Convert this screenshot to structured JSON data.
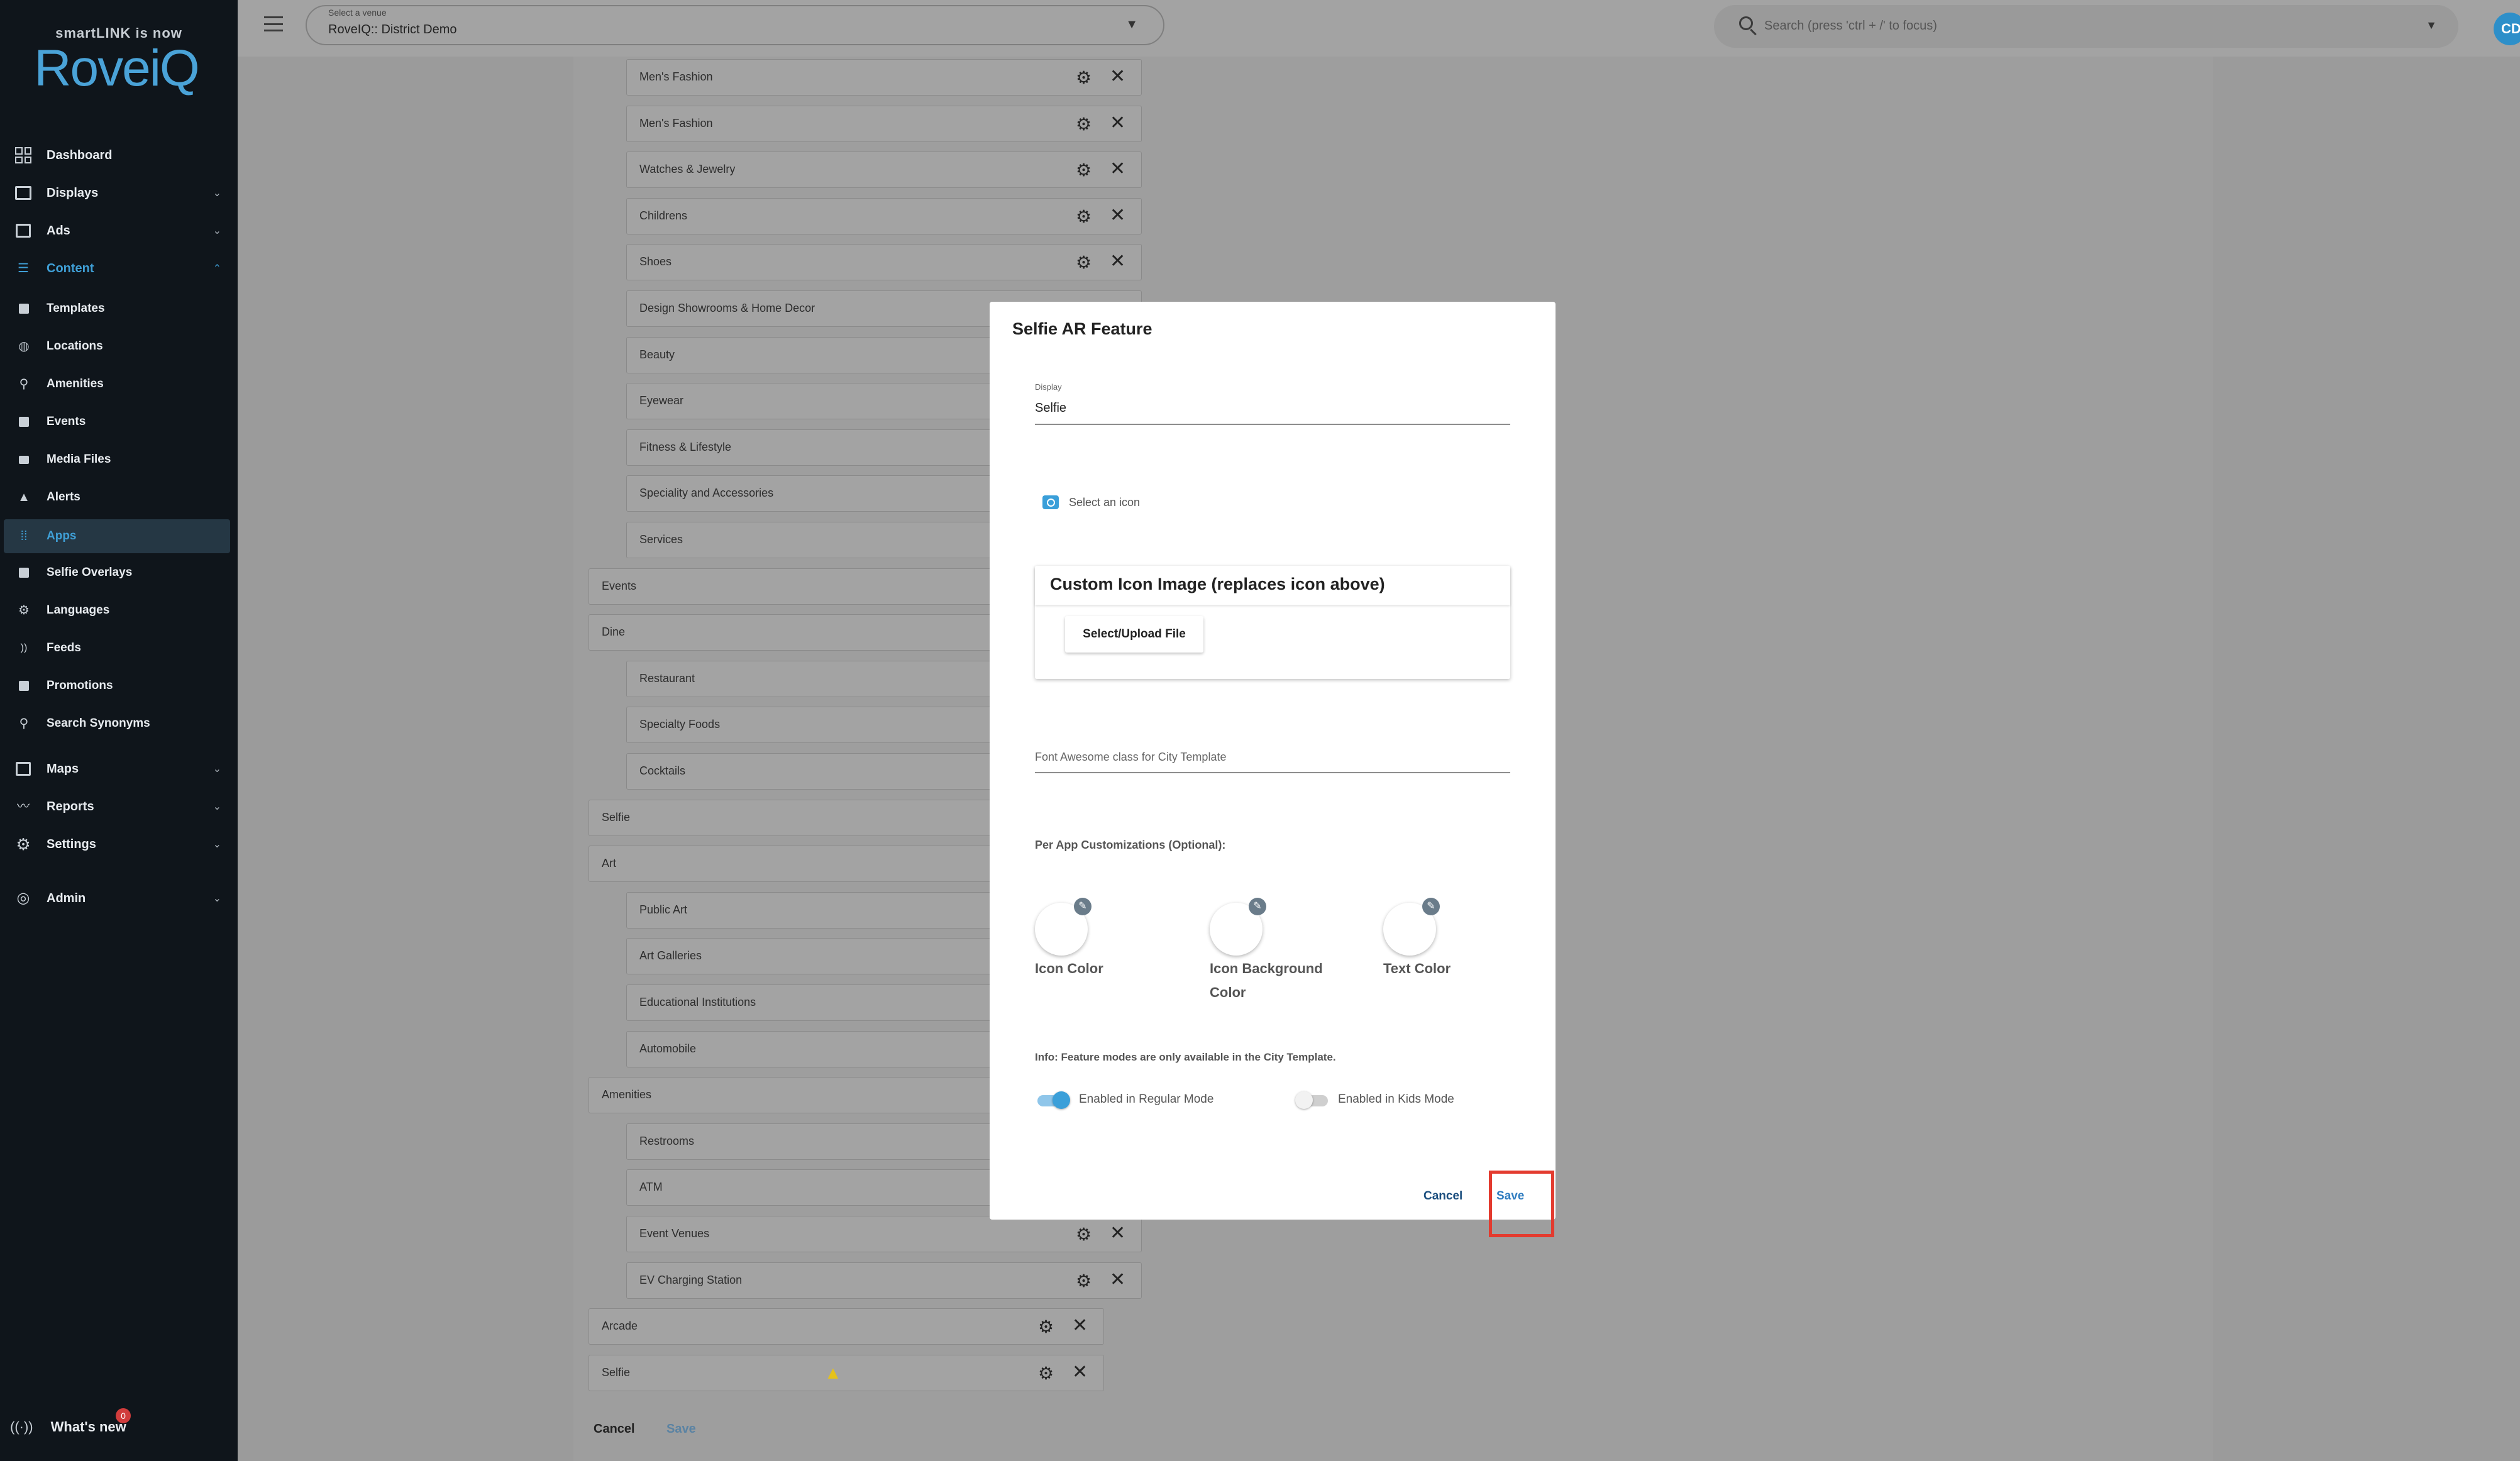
{
  "brand": {
    "tagline": "smartLINK is now",
    "logo": "RoveiQ"
  },
  "sidebar": {
    "items": [
      {
        "label": "Dashboard",
        "icon": "dashboard-icon"
      },
      {
        "label": "Displays",
        "icon": "displays-icon"
      },
      {
        "label": "Ads",
        "icon": "ads-icon"
      },
      {
        "label": "Content",
        "icon": "database-icon"
      },
      {
        "label": "Templates",
        "icon": "templates-icon"
      },
      {
        "label": "Locations",
        "icon": "location-pin-icon"
      },
      {
        "label": "Amenities",
        "icon": "amenities-icon"
      },
      {
        "label": "Events",
        "icon": "calendar-icon"
      },
      {
        "label": "Media Files",
        "icon": "folder-icon"
      },
      {
        "label": "Alerts",
        "icon": "warning-icon"
      },
      {
        "label": "Apps",
        "icon": "apps-grid-icon"
      },
      {
        "label": "Selfie Overlays",
        "icon": "selfie-icon"
      },
      {
        "label": "Languages",
        "icon": "gear-icon"
      },
      {
        "label": "Feeds",
        "icon": "rss-icon"
      },
      {
        "label": "Promotions",
        "icon": "promotions-icon"
      },
      {
        "label": "Search Synonyms",
        "icon": "search-icon"
      },
      {
        "label": "Maps",
        "icon": "map-icon"
      },
      {
        "label": "Reports",
        "icon": "reports-icon"
      },
      {
        "label": "Settings",
        "icon": "gear-icon"
      },
      {
        "label": "Admin",
        "icon": "admin-icon"
      }
    ],
    "whats_new": {
      "label": "What's new",
      "badge": "0"
    }
  },
  "topbar": {
    "venue_label": "Select a venue",
    "venue_value": "RoveIQ:: District Demo",
    "search_placeholder": "Search (press 'ctrl + /' to focus)",
    "avatar_initials": "CD"
  },
  "content": {
    "rows": [
      "Men's Fashion",
      "Men's Fashion",
      "Watches & Jewelry",
      "Childrens",
      "Shoes",
      "Design Showrooms & Home Decor",
      "Beauty",
      "Eyewear",
      "Fitness & Lifestyle",
      "Speciality and Accessories",
      "Services",
      "Events",
      "Dine",
      "Restaurant",
      "Specialty Foods",
      "Cocktails",
      "Selfie",
      "Art",
      "Public Art",
      "Art Galleries",
      "Educational Institutions",
      "Automobile",
      "Amenities",
      "Restrooms",
      "ATM",
      "Event Venues",
      "EV Charging Station",
      "Arcade",
      "Selfie"
    ],
    "cancel_label": "Cancel",
    "save_label": "Save"
  },
  "modal": {
    "title": "Selfie AR Feature",
    "display_label": "Display",
    "display_value": "Selfie",
    "select_icon_label": "Select an icon",
    "custom_icon_title": "Custom Icon Image (replaces icon above)",
    "upload_label": "Select/Upload File",
    "fa_placeholder": "Font Awesome class for City Template",
    "per_app_label": "Per App Customizations (Optional):",
    "colors": [
      {
        "label": "Icon Color"
      },
      {
        "label": "Icon Background Color"
      },
      {
        "label": "Text Color"
      }
    ],
    "info": "Info: Feature modes are only available in the City Template.",
    "toggles": [
      {
        "label": "Enabled in Regular Mode",
        "on": true
      },
      {
        "label": "Enabled in Kids Mode",
        "on": false
      }
    ],
    "cancel_label": "Cancel",
    "save_label": "Save"
  },
  "colors": {
    "accent": "#3a9fd9",
    "sidebar_bg": "#0f151b",
    "highlight": "#e33b2f"
  }
}
